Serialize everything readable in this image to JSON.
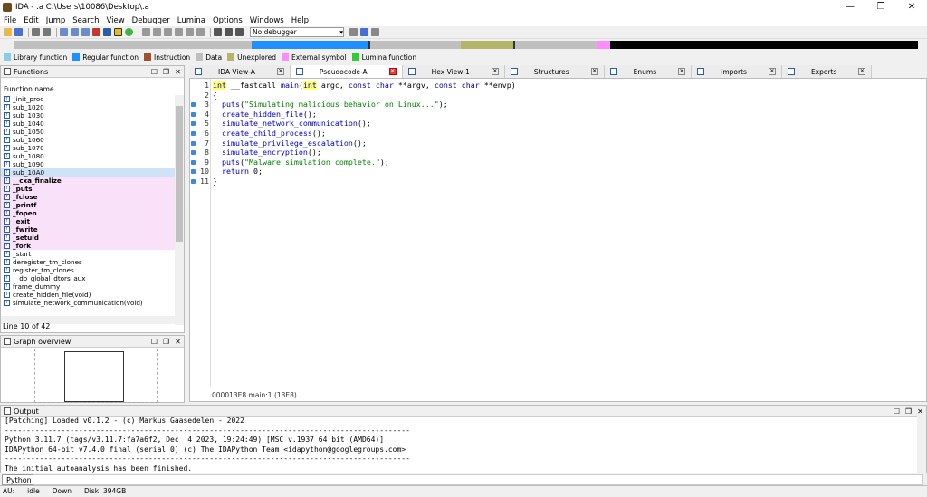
{
  "window": {
    "title": "IDA - .a C:\\Users\\10086\\Desktop\\.a",
    "min": "—",
    "max": "❐",
    "close": "✕"
  },
  "menu": [
    "File",
    "Edit",
    "Jump",
    "Search",
    "View",
    "Debugger",
    "Lumina",
    "Options",
    "Windows",
    "Help"
  ],
  "toolbar": {
    "debugger_select": "No debugger"
  },
  "legend": [
    {
      "label": "Library function",
      "color": "#87ceeb"
    },
    {
      "label": "Regular function",
      "color": "#1e90ff"
    },
    {
      "label": "Instruction",
      "color": "#a0522d"
    },
    {
      "label": "Data",
      "color": "#bfbfbf"
    },
    {
      "label": "Unexplored",
      "color": "#b5b56a"
    },
    {
      "label": "External symbol",
      "color": "#ff8cff"
    },
    {
      "label": "Lumina function",
      "color": "#33cc33"
    }
  ],
  "functions_panel": {
    "title": "Functions",
    "column_header": "Function name",
    "items": [
      {
        "name": "_init_proc",
        "lib": false
      },
      {
        "name": "sub_1020",
        "lib": false
      },
      {
        "name": "sub_1030",
        "lib": false
      },
      {
        "name": "sub_1040",
        "lib": false
      },
      {
        "name": "sub_1050",
        "lib": false
      },
      {
        "name": "sub_1060",
        "lib": false
      },
      {
        "name": "sub_1070",
        "lib": false
      },
      {
        "name": "sub_1080",
        "lib": false
      },
      {
        "name": "sub_1090",
        "lib": false
      },
      {
        "name": "sub_10A0",
        "lib": false,
        "sel": true
      },
      {
        "name": "__cxa_finalize",
        "lib": true
      },
      {
        "name": "_puts",
        "lib": true
      },
      {
        "name": "_fclose",
        "lib": true
      },
      {
        "name": "_printf",
        "lib": true
      },
      {
        "name": "_fopen",
        "lib": true
      },
      {
        "name": "_exit",
        "lib": true
      },
      {
        "name": "_fwrite",
        "lib": true
      },
      {
        "name": "_setuid",
        "lib": true
      },
      {
        "name": "_fork",
        "lib": true
      },
      {
        "name": "_start",
        "lib": false
      },
      {
        "name": "deregister_tm_clones",
        "lib": false
      },
      {
        "name": "register_tm_clones",
        "lib": false
      },
      {
        "name": "__do_global_dtors_aux",
        "lib": false
      },
      {
        "name": "frame_dummy",
        "lib": false
      },
      {
        "name": "create_hidden_file(void)",
        "lib": false
      },
      {
        "name": "simulate_network_communication(void)",
        "lib": false
      }
    ],
    "status": "Line 10 of 42"
  },
  "graph_panel": {
    "title": "Graph overview"
  },
  "tabs": [
    {
      "label": "IDA View-A",
      "active": false
    },
    {
      "label": "Pseudocode-A",
      "active": true
    },
    {
      "label": "Hex View-1",
      "active": false
    },
    {
      "label": "Structures",
      "active": false
    },
    {
      "label": "Enums",
      "active": false
    },
    {
      "label": "Imports",
      "active": false
    },
    {
      "label": "Exports",
      "active": false
    }
  ],
  "code": {
    "lines": [
      {
        "n": "1",
        "bp": false,
        "html": "<span class='kw hl'>int</span> __fastcall <span class='fn'>main</span>(<span class='kw hl'>int</span> argc, <span class='kw'>const char</span> **argv, <span class='kw'>const char</span> **envp)"
      },
      {
        "n": "2",
        "bp": false,
        "html": "{"
      },
      {
        "n": "3",
        "bp": true,
        "html": "  <span class='fn'>puts</span>(<span class='st'>\"Simulating malicious behavior on Linux...\"</span>);"
      },
      {
        "n": "4",
        "bp": true,
        "html": "  <span class='fn'>create_hidden_file</span>();"
      },
      {
        "n": "5",
        "bp": true,
        "html": "  <span class='fn'>simulate_network_communication</span>();"
      },
      {
        "n": "6",
        "bp": true,
        "html": "  <span class='fn'>create_child_process</span>();"
      },
      {
        "n": "7",
        "bp": true,
        "html": "  <span class='fn'>simulate_privilege_escalation</span>();"
      },
      {
        "n": "8",
        "bp": true,
        "html": "  <span class='fn'>simulate_encryption</span>();"
      },
      {
        "n": "9",
        "bp": true,
        "html": "  <span class='fn'>puts</span>(<span class='st'>\"Malware simulation complete.\"</span>);"
      },
      {
        "n": "10",
        "bp": true,
        "html": "  <span class='kw'>return</span> 0;"
      },
      {
        "n": "11",
        "bp": true,
        "html": "}"
      }
    ],
    "status": "000013E8 main:1 (13E8)"
  },
  "output": {
    "title": "Output",
    "lines": [
      "[Patching] Loaded v0.1.2 - (c) Markus Gaasedelen - 2022",
      "---------------------------------------------------------------------------------------------",
      "Python 3.11.7 (tags/v3.11.7:fa7a6f2, Dec  4 2023, 19:24:49) [MSC v.1937 64 bit (AMD64)]",
      "IDAPython 64-bit v7.4.0 final (serial 0) (c) The IDAPython Team <idapython@googlegroups.com>",
      "---------------------------------------------------------------------------------------------",
      "The initial autoanalysis has been finished."
    ]
  },
  "python_button": "Python",
  "statusbar": {
    "au": "AU:",
    "state": "idle",
    "dir": "Down",
    "disk": "Disk: 394GB"
  }
}
